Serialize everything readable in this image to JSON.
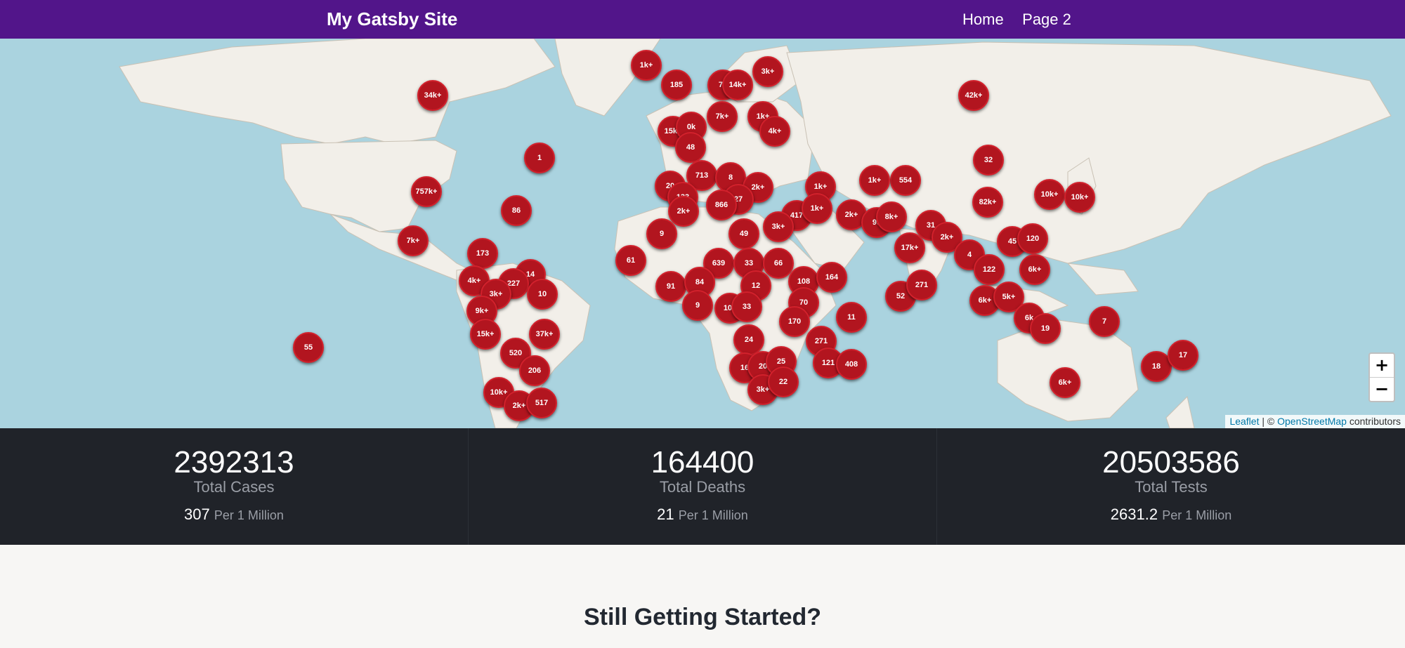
{
  "header": {
    "title": "My Gatsby Site",
    "nav": [
      "Home",
      "Page 2"
    ],
    "bg_color": "#52158a"
  },
  "map": {
    "ocean_color": "#aad3df",
    "land_color": "#f2efe9",
    "marker_color": "#b2151f",
    "markers": [
      "1k+",
      "185",
      "7k",
      "14k+",
      "3k+",
      "34k+",
      "42k+",
      "7k+",
      "1k+",
      "15k+",
      "0k",
      "4k+",
      "48",
      "1",
      "32",
      "757k+",
      "713",
      "8",
      "2k+",
      "1k+",
      "554",
      "1k+",
      "20",
      "133",
      "27",
      "866",
      "2k+",
      "417",
      "3k+",
      "1k+",
      "82k+",
      "10k+",
      "10k+",
      "86",
      "7k+",
      "9",
      "173",
      "49",
      "2k+",
      "99",
      "8k+",
      "31",
      "2k+",
      "45",
      "120",
      "4",
      "14",
      "61",
      "639",
      "33",
      "66",
      "108",
      "122",
      "6k+",
      "4k+",
      "227",
      "91",
      "84",
      "12",
      "164",
      "17k+",
      "3k+",
      "10",
      "9",
      "109",
      "33",
      "70",
      "52",
      "271",
      "6k+",
      "5k+",
      "9k+",
      "170",
      "11",
      "6k",
      "19",
      "7",
      "15k+",
      "37k+",
      "24",
      "271",
      "520",
      "55",
      "206",
      "16",
      "20",
      "25",
      "121",
      "408",
      "18",
      "17",
      "6k+",
      "10k+",
      "2k+",
      "517",
      "3k+",
      "22"
    ],
    "attribution": {
      "leaflet": "Leaflet",
      "separator": " | © ",
      "osm": "OpenStreetMap",
      "contributors": " contributors"
    },
    "zoom_in": "+",
    "zoom_out": "−"
  },
  "stats": [
    {
      "value": "2392313",
      "label": "Total Cases",
      "per_million": "307",
      "unit": "Per 1 Million"
    },
    {
      "value": "164400",
      "label": "Total Deaths",
      "per_million": "21",
      "unit": "Per 1 Million"
    },
    {
      "value": "20503586",
      "label": "Total Tests",
      "per_million": "2631.2",
      "unit": "Per 1 Million"
    }
  ],
  "section": {
    "heading": "Still Getting Started?"
  }
}
